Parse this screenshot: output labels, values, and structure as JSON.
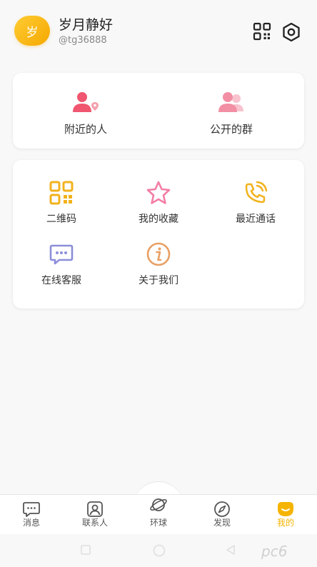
{
  "profile": {
    "avatar_text": "岁",
    "name": "岁月静好",
    "handle": "@tg36888",
    "qr_icon": "qr-code-icon",
    "settings_icon": "settings-hexagon-icon"
  },
  "social": {
    "items": [
      {
        "label": "附近的人",
        "icon": "nearby-people-icon"
      },
      {
        "label": "公开的群",
        "icon": "public-group-icon"
      }
    ]
  },
  "tools": {
    "items": [
      {
        "label": "二维码",
        "icon": "qr-code-icon"
      },
      {
        "label": "我的收藏",
        "icon": "star-icon"
      },
      {
        "label": "最近通话",
        "icon": "phone-call-icon"
      },
      {
        "label": "在线客服",
        "icon": "chat-bubble-icon"
      },
      {
        "label": "关于我们",
        "icon": "info-icon"
      }
    ]
  },
  "tabbar": {
    "items": [
      {
        "label": "消息",
        "icon": "message-icon"
      },
      {
        "label": "联系人",
        "icon": "contacts-icon"
      },
      {
        "label": "环球",
        "icon": "planet-icon"
      },
      {
        "label": "发现",
        "icon": "compass-icon"
      },
      {
        "label": "我的",
        "icon": "me-icon"
      }
    ],
    "active_index": 4
  },
  "watermark": "pc6",
  "colors": {
    "accent": "#f5b400",
    "nearby": "#f0566f",
    "group": "#f28fa4",
    "qr": "#f2b21d",
    "star": "#f27ea6",
    "phone": "#f2b21d",
    "chat": "#8c8fd9",
    "info": "#e9a064"
  }
}
